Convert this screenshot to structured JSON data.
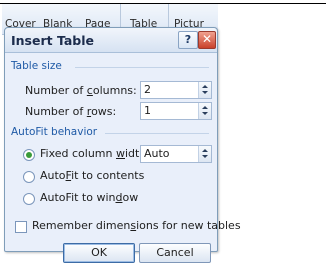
{
  "ribbon": {
    "items": [
      "Cover",
      "Blank",
      "Page",
      "Table",
      "Pictur"
    ]
  },
  "dialog": {
    "title": "Insert Table",
    "help_glyph": "?",
    "close_glyph": "✕",
    "table_size": {
      "heading": "Table size",
      "columns_label_pre": "Number of ",
      "columns_label_key": "c",
      "columns_label_post": "olumns:",
      "columns_value": "2",
      "rows_label_pre": "Number of ",
      "rows_label_key": "r",
      "rows_label_post": "ows:",
      "rows_value": "1"
    },
    "autofit": {
      "heading": "AutoFit behavior",
      "fixed_pre": "Fixed column ",
      "fixed_key": "w",
      "fixed_post": "idth:",
      "fixed_value": "Auto",
      "contents_pre": "Auto",
      "contents_key": "F",
      "contents_post": "it to contents",
      "window_pre": "AutoFit to win",
      "window_key": "d",
      "window_post": "ow",
      "selected": "fixed"
    },
    "remember_pre": "Remember dimen",
    "remember_key": "s",
    "remember_post": "ions for new tables",
    "remember_checked": false,
    "ok_label": "OK",
    "cancel_label": "Cancel"
  }
}
